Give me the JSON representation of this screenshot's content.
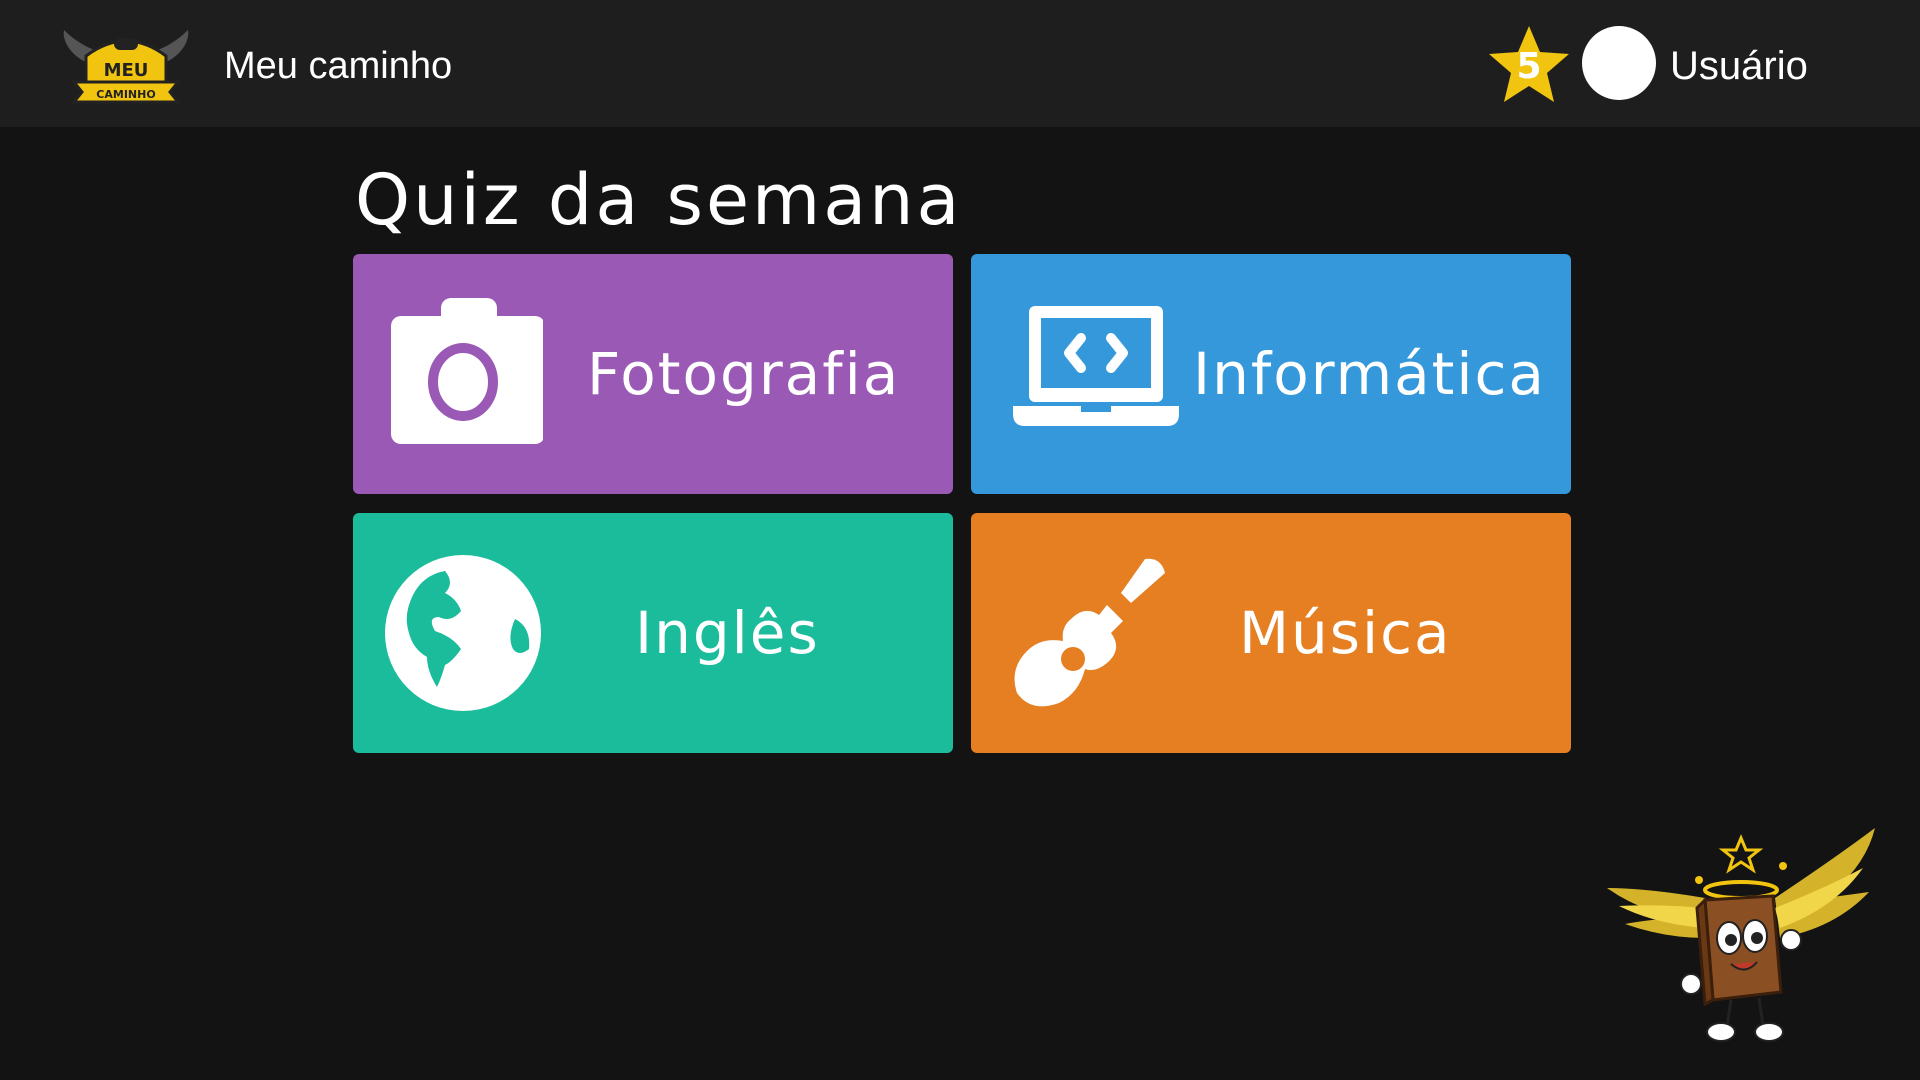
{
  "header": {
    "app_title": "Meu caminho",
    "logo": {
      "line1": "MEU",
      "line2": "CAMINHO",
      "icon": "winged-gamepad-logo"
    },
    "star_count": "5",
    "user_name": "Usuário"
  },
  "main": {
    "title": "Quiz da semana",
    "tiles": [
      {
        "label": "Fotografia",
        "icon": "camera-icon",
        "color": "#9b59b6"
      },
      {
        "label": "Informática",
        "icon": "laptop-code-icon",
        "color": "#3498db"
      },
      {
        "label": "Inglês",
        "icon": "globe-icon",
        "color": "#1abc9c"
      },
      {
        "label": "Música",
        "icon": "guitar-icon",
        "color": "#e67e22"
      }
    ]
  },
  "colors": {
    "background": "#131313",
    "header_background": "#1e1e1e",
    "star": "#f1c40f",
    "text": "#ffffff"
  },
  "mascot": {
    "icon": "winged-book-mascot"
  }
}
